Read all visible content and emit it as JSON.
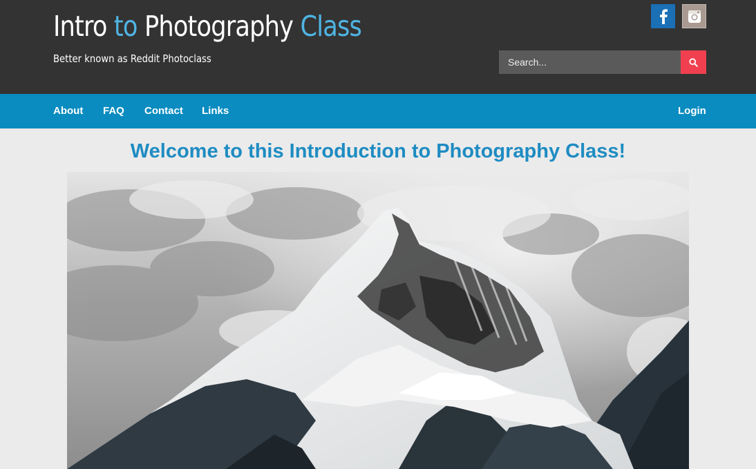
{
  "header": {
    "title_part1": "Intro ",
    "title_accent1": "to",
    "title_part2": " Photography ",
    "title_accent2": "Class",
    "tagline": "Better known as Reddit Photoclass",
    "background_color": "#333333",
    "accent_color": "#4fb4e3"
  },
  "social": {
    "facebook_icon": "facebook-icon",
    "instagram_icon": "instagram-icon"
  },
  "search": {
    "placeholder": "Search...",
    "button_icon": "search-icon",
    "button_color": "#f0404f"
  },
  "nav": {
    "background_color": "#0a8cc0",
    "items": [
      {
        "label": "About"
      },
      {
        "label": "FAQ"
      },
      {
        "label": "Contact"
      },
      {
        "label": "Links"
      }
    ],
    "login_label": "Login"
  },
  "main": {
    "heading": "Welcome to this Introduction to Photography Class!",
    "heading_color": "#1e8cc2",
    "hero_image": "snow-capped-mountain-peak-black-and-white"
  }
}
